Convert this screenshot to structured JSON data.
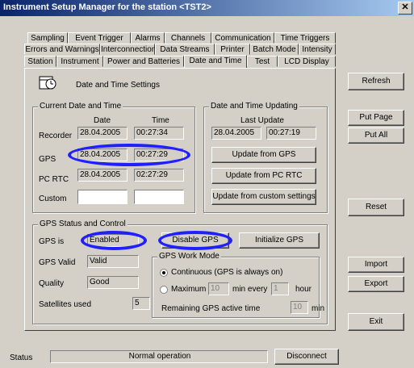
{
  "window": {
    "title": "Instrument Setup Manager for the station <TST2>",
    "close": "✕"
  },
  "tabs": {
    "row1": [
      "Sampling",
      "Event Trigger",
      "Alarms",
      "Channels",
      "Communication",
      "Time Triggers"
    ],
    "row2": [
      "Errors and Warnings",
      "Interconnection",
      "Data Streams",
      "Printer",
      "Batch Mode",
      "Intensity"
    ],
    "row3": [
      "Station",
      "Instrument",
      "Power and Batteries",
      "Date and Time",
      "Test",
      "LCD Display"
    ],
    "active": "Date and Time"
  },
  "page": {
    "header": "Date and Time Settings",
    "icon": "clock-calendar-icon"
  },
  "current": {
    "legend": "Current Date and Time",
    "col_date": "Date",
    "col_time": "Time",
    "rows": [
      {
        "label": "Recorder",
        "date": "28.04.2005",
        "time": "00:27:34"
      },
      {
        "label": "GPS",
        "date": "28.04.2005",
        "time": "00:27:29"
      },
      {
        "label": "PC RTC",
        "date": "28.04.2005",
        "time": "02:27:29"
      },
      {
        "label": "Custom",
        "date": "",
        "time": ""
      }
    ]
  },
  "updating": {
    "legend": "Date and Time Updating",
    "last_update_label": "Last Update",
    "last_date": "28.04.2005",
    "last_time": "00:27:19",
    "btn_gps": "Update from GPS",
    "btn_pc": "Update from PC RTC",
    "btn_custom": "Update from custom settings"
  },
  "gps": {
    "legend": "GPS Status and Control",
    "is_label": "GPS is",
    "is_value": "Enabled",
    "btn_disable": "Disable GPS",
    "btn_init": "Initialize GPS",
    "valid_label": "GPS Valid",
    "valid_value": "Valid",
    "quality_label": "Quality",
    "quality_value": "Good",
    "sats_label": "Satellites used",
    "sats_value": "5",
    "mode_legend": "GPS Work Mode",
    "mode_continuous": "Continuous (GPS is always on)",
    "mode_maximum": "Maximum",
    "max_value": "10",
    "every_label": "min every",
    "every_value": "1",
    "hour_label": "hour",
    "remaining_label": "Remaining GPS active time",
    "remaining_value": "10",
    "min_label": "min"
  },
  "side": {
    "refresh": "Refresh",
    "put_page": "Put Page",
    "put_all": "Put All",
    "reset": "Reset",
    "import": "Import",
    "export": "Export",
    "exit": "Exit"
  },
  "status": {
    "label": "Status",
    "value": "Normal operation",
    "disconnect": "Disconnect"
  }
}
